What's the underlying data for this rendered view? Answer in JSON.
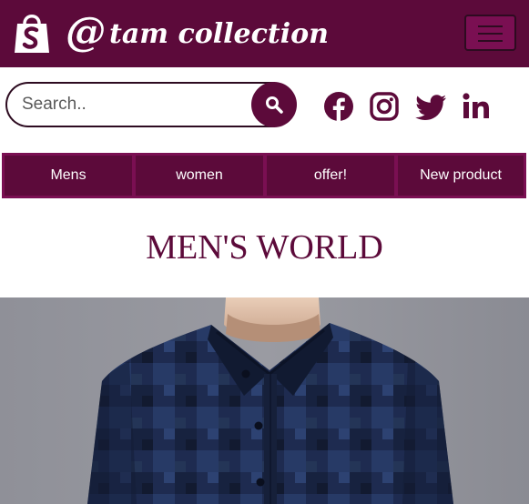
{
  "header": {
    "brand": "@tam collection",
    "brand_at": "@",
    "brand_rest": "tam collection",
    "logo_icon": "shopping-bag-icon",
    "menu_icon": "hamburger-menu-icon"
  },
  "search": {
    "placeholder": "Search..",
    "value": "",
    "button_icon": "search-icon"
  },
  "social": [
    {
      "name": "facebook",
      "icon": "facebook-icon"
    },
    {
      "name": "instagram",
      "icon": "instagram-icon"
    },
    {
      "name": "twitter",
      "icon": "twitter-icon"
    },
    {
      "name": "linkedin",
      "icon": "linkedin-icon"
    }
  ],
  "nav": {
    "items": [
      {
        "label": "Mens"
      },
      {
        "label": "women"
      },
      {
        "label": "offer!"
      },
      {
        "label": "New product"
      }
    ]
  },
  "main": {
    "title": "MEN'S WORLD"
  },
  "colors": {
    "primary": "#5c0a3a",
    "primary_light": "#7a0f52",
    "shirt": "#1d2a4e",
    "background": "#ffffff"
  }
}
